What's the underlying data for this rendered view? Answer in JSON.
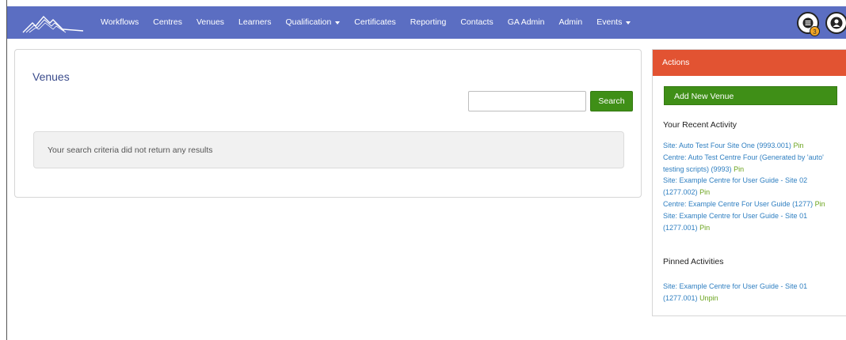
{
  "navbar": {
    "items": [
      {
        "label": "Workflows"
      },
      {
        "label": "Centres"
      },
      {
        "label": "Venues"
      },
      {
        "label": "Learners"
      },
      {
        "label": "Qualification",
        "dropdown": true
      },
      {
        "label": "Certificates"
      },
      {
        "label": "Reporting"
      },
      {
        "label": "Contacts"
      },
      {
        "label": "GA Admin"
      },
      {
        "label": "Admin"
      },
      {
        "label": "Events",
        "dropdown": true
      }
    ],
    "notifications_badge": "3",
    "icons": [
      "logo-mountain-icon",
      "list-icon",
      "user-icon"
    ],
    "color": "#5b6ec2"
  },
  "main": {
    "title": "Venues",
    "search": {
      "value": "",
      "button_label": "Search"
    },
    "empty_message": "Your search criteria did not return any results"
  },
  "sidebar": {
    "header": "Actions",
    "add_button_label": "Add New Venue",
    "recent_title": "Your Recent Activity",
    "recent_items": [
      {
        "text": "Site: Auto Test Four Site One (9993.001)",
        "action": "Pin"
      },
      {
        "text": "Centre: Auto Test Centre Four (Generated by 'auto' testing scripts) (9993)",
        "action": "Pin"
      },
      {
        "text": "Site: Example Centre for User Guide - Site 02 (1277.002)",
        "action": "Pin"
      },
      {
        "text": "Centre: Example Centre For User Guide (1277)",
        "action": "Pin"
      },
      {
        "text": "Site: Example Centre for User Guide - Site 01 (1277.001)",
        "action": "Pin"
      }
    ],
    "pinned_title": "Pinned Activities",
    "pinned_items": [
      {
        "text": "Site: Example Centre for User Guide - Site 01 (1277.001)",
        "action": "Unpin"
      }
    ]
  },
  "colors": {
    "header_red": "#e25332",
    "button_green": "#3f8f17",
    "link_blue": "#2f7fc1",
    "pin_green": "#6aa31c"
  }
}
